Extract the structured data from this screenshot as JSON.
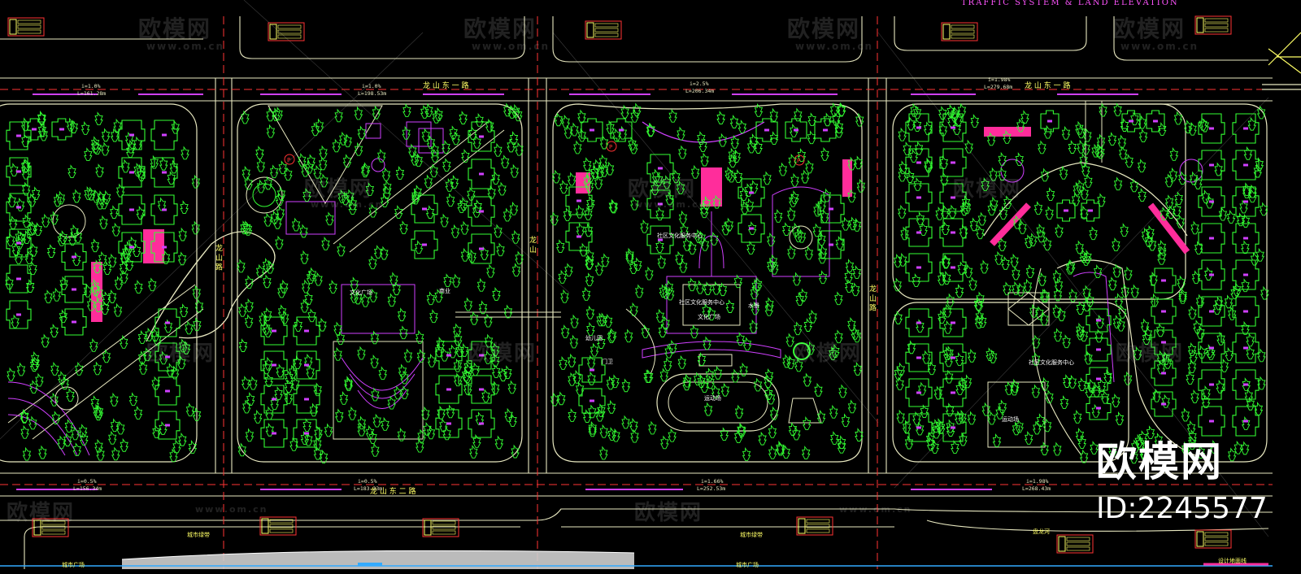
{
  "title": "TRAFFIC SYSTEM & LAND ELEVATION",
  "watermark": {
    "logo_text": "欧模网",
    "domain": "www.om.cn"
  },
  "brand": {
    "name": "欧模网",
    "id": "ID:2245577"
  },
  "roads": {
    "north_road": "龙 山 东 一 路",
    "south_road": "龙 山 东 二 路",
    "west_road": "龙 山 路",
    "middle_road": "龙 山",
    "east_road": "龙 山 路"
  },
  "slopes": [
    {
      "i": "i=1.0%",
      "l": "L=161.28m"
    },
    {
      "i": "i=1.0%",
      "l": "L=198.53m"
    },
    {
      "i": "i=2.5%",
      "l": "L=206.34m"
    },
    {
      "i": "i=1.98%",
      "l": "L=279.68m"
    },
    {
      "i": "i=0.5%",
      "l": "L=156.34m"
    },
    {
      "i": "i=0.5%",
      "l": "L=183.33m"
    },
    {
      "i": "i=1.66%",
      "l": "L=252.53m"
    },
    {
      "i": "i=1.98%",
      "l": "L=268.43m"
    }
  ],
  "labels": {
    "culture_square": "文化广场",
    "community_center": "社区文化服务中心",
    "sports_ground": "运动场",
    "kindergarten": "幼儿园",
    "main_gate": "门卫",
    "water": "水景",
    "commercial": "商业",
    "city_green": "城市绿带",
    "river": "盘龙河",
    "design_line": "设计地面线",
    "city_square": "城市广场",
    "parking": "P"
  },
  "colors": {
    "building": "#33ff33",
    "road": "#e8e8c0",
    "pink": "#ff2d9b",
    "magenta": "#d040ff",
    "title": "#ff55ff",
    "table_red": "#ff3333",
    "table_yellow": "#ffff66"
  }
}
